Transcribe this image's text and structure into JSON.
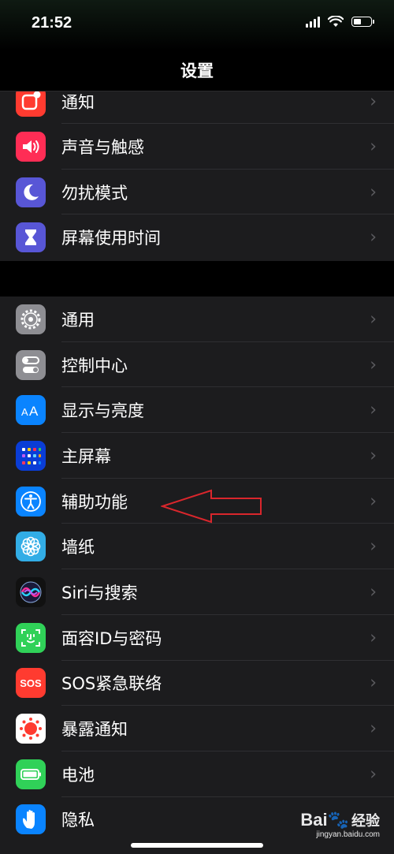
{
  "status_bar": {
    "time": "21:52",
    "icons": [
      "signal-icon",
      "wifi-icon",
      "battery-icon"
    ]
  },
  "nav": {
    "title": "设置"
  },
  "groups": [
    {
      "items": [
        {
          "label": "通知",
          "icon": "notification-icon",
          "color": "#ff3b30"
        },
        {
          "label": "声音与触感",
          "icon": "speaker-icon",
          "color": "#ff2d55"
        },
        {
          "label": "勿扰模式",
          "icon": "moon-icon",
          "color": "#5856d6"
        },
        {
          "label": "屏幕使用时间",
          "icon": "hourglass-icon",
          "color": "#5856d6"
        }
      ]
    },
    {
      "items": [
        {
          "label": "通用",
          "icon": "gear-icon",
          "color": "#8e8e93"
        },
        {
          "label": "控制中心",
          "icon": "toggles-icon",
          "color": "#8e8e93"
        },
        {
          "label": "显示与亮度",
          "icon": "text-size-icon",
          "color": "#0a84ff"
        },
        {
          "label": "主屏幕",
          "icon": "home-grid-icon",
          "color": "#0a3dd6"
        },
        {
          "label": "辅助功能",
          "icon": "accessibility-icon",
          "color": "#0a84ff"
        },
        {
          "label": "墙纸",
          "icon": "flower-icon",
          "color": "#32ade6"
        },
        {
          "label": "Siri与搜索",
          "icon": "siri-icon",
          "color": "#111111"
        },
        {
          "label": "面容ID与密码",
          "icon": "face-id-icon",
          "color": "#30d158"
        },
        {
          "label": "SOS紧急联络",
          "icon": "sos-icon",
          "color": "#ff3b30"
        },
        {
          "label": "暴露通知",
          "icon": "exposure-icon",
          "color": "#ffffff"
        },
        {
          "label": "电池",
          "icon": "battery-icon",
          "color": "#30d158"
        },
        {
          "label": "隐私",
          "icon": "hand-icon",
          "color": "#0a84ff"
        }
      ]
    }
  ],
  "chevron": "›",
  "sos_text": "SOS",
  "watermark": {
    "brand": "Bai",
    "brand2": "经验",
    "url": "jingyan.baidu.com"
  },
  "annotation": {
    "type": "arrow",
    "color": "#d9262c",
    "points_to": "辅助功能"
  }
}
